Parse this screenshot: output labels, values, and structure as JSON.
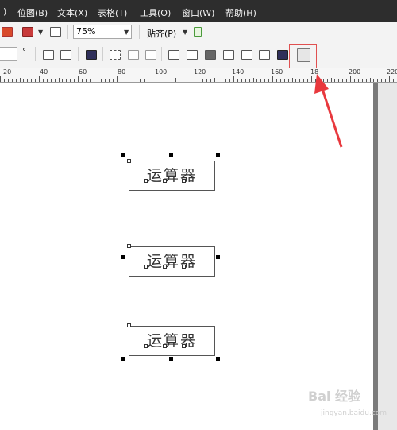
{
  "menu": {
    "items": [
      {
        "label": ")"
      },
      {
        "label": "位图(B)"
      },
      {
        "label": "文本(X)"
      },
      {
        "label": "表格(T)"
      },
      {
        "label": "工具(O)"
      },
      {
        "label": "窗口(W)"
      },
      {
        "label": "帮助(H)"
      }
    ]
  },
  "toolbar1": {
    "zoom_value": "75%",
    "snap_label": "贴齐(P)"
  },
  "toolbar2": {
    "degree_symbol": "°"
  },
  "ruler": {
    "labels": [
      "20",
      "40",
      "60",
      "80",
      "100",
      "120",
      "140",
      "160",
      "18",
      "200",
      "220"
    ]
  },
  "canvas": {
    "objects": [
      {
        "text": "运算器"
      },
      {
        "text": "运算器"
      },
      {
        "text": "运算器"
      }
    ]
  },
  "watermark": {
    "text": "Bai 经验",
    "sub": "jingyan.baidu.com"
  },
  "colors": {
    "menubar_bg": "#2d2d2d",
    "highlight": "#e05050",
    "arrow": "#e8383d"
  },
  "icons": [
    "bring-forward-icon",
    "align-icon",
    "group-icon",
    "snap-icon",
    "arrange-icon"
  ]
}
